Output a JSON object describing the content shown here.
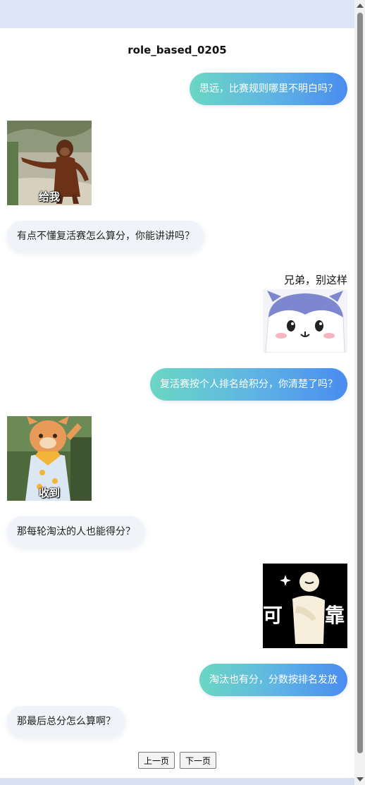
{
  "chat": {
    "title": "role_based_0205",
    "messages": [
      {
        "side": "right",
        "type": "text",
        "text": "思远，比赛规则哪里不明白吗？"
      },
      {
        "side": "left",
        "type": "sticker",
        "sticker": "orangutan-give-me",
        "caption": "给我"
      },
      {
        "side": "left",
        "type": "text",
        "text": "有点不懂复活赛怎么算分，你能讲讲吗？"
      },
      {
        "side": "right",
        "type": "sticker",
        "sticker": "chiikawa-hachiware",
        "label": "兄弟，别这样"
      },
      {
        "side": "right",
        "type": "text",
        "text": "复活赛按个人排名给积分，你清楚了吗？"
      },
      {
        "side": "left",
        "type": "sticker",
        "sticker": "mascot-salute",
        "caption": "收到"
      },
      {
        "side": "left",
        "type": "text",
        "text": "那每轮淘汰的人也能得分？"
      },
      {
        "side": "right",
        "type": "sticker",
        "sticker": "reliable-figure",
        "caption_left": "可",
        "caption_right": "靠"
      },
      {
        "side": "right",
        "type": "text",
        "text": "淘汰也有分，分数按排名发放"
      },
      {
        "side": "left",
        "type": "text",
        "text": "那最后总分怎么算啊？"
      }
    ]
  },
  "pager": {
    "prev_label": "上一页",
    "next_label": "下一页"
  },
  "colors": {
    "bubble_right_gradient_start": "#6ad7c2",
    "bubble_right_gradient_end": "#4a8cf0",
    "bubble_left_bg": "#f0f3f8"
  }
}
